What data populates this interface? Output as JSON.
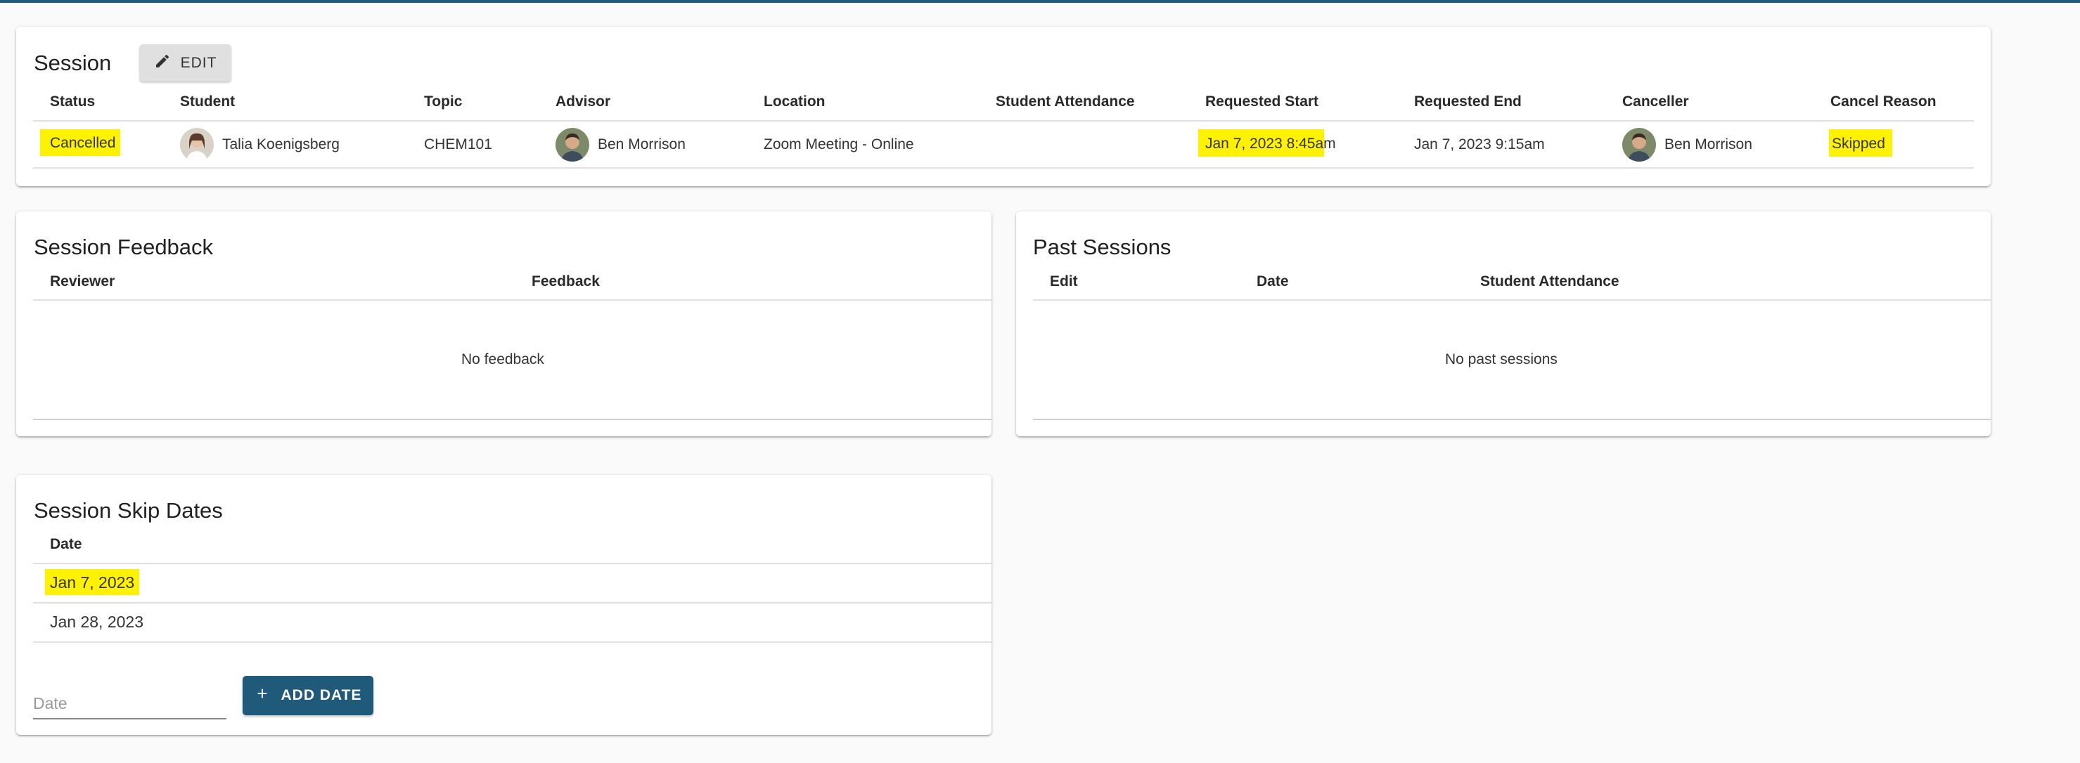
{
  "colors": {
    "accent": "#1f5a7a",
    "highlight": "#fff200"
  },
  "session": {
    "title": "Session",
    "edit_label": "EDIT",
    "headers": [
      "Status",
      "Student",
      "Topic",
      "Advisor",
      "Location",
      "Student Attendance",
      "Requested Start",
      "Requested End",
      "Canceller",
      "Cancel Reason"
    ],
    "row": {
      "status": "Cancelled",
      "student": "Talia Koenigsberg",
      "topic": "CHEM101",
      "advisor": "Ben Morrison",
      "location": "Zoom Meeting - Online",
      "student_attendance": "",
      "requested_start": "Jan 7, 2023 8:45am",
      "requested_end": "Jan 7, 2023 9:15am",
      "canceller": "Ben Morrison",
      "cancel_reason": "Skipped"
    }
  },
  "feedback": {
    "title": "Session Feedback",
    "headers": [
      "Reviewer",
      "Feedback"
    ],
    "empty": "No feedback"
  },
  "past": {
    "title": "Past Sessions",
    "headers": [
      "Edit",
      "Date",
      "Student Attendance"
    ],
    "empty": "No past sessions"
  },
  "skip": {
    "title": "Session Skip Dates",
    "header": "Date",
    "dates": [
      "Jan 7, 2023",
      "Jan 28, 2023"
    ],
    "input_placeholder": "Date",
    "add_label": "ADD DATE"
  }
}
